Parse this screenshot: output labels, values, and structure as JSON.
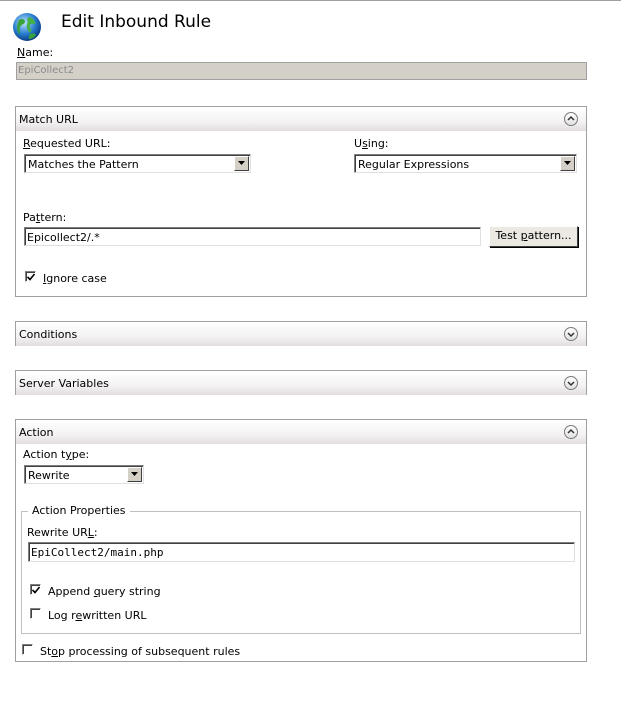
{
  "header": {
    "title": "Edit Inbound Rule",
    "icon": "globe-icon"
  },
  "name": {
    "label_pre": "",
    "label_key": "N",
    "label_post": "ame:",
    "value": "EpiCollect2"
  },
  "match_url": {
    "title": "Match URL",
    "requested_url": {
      "label_pre": "",
      "label_key": "R",
      "label_post": "equested URL:",
      "value": "Matches the Pattern"
    },
    "using": {
      "label_pre": "U",
      "label_key": "s",
      "label_post": "ing:",
      "value": "Regular Expressions"
    },
    "pattern": {
      "label_pre": "Pa",
      "label_key": "t",
      "label_post": "tern:",
      "value": "Epicollect2/.*"
    },
    "test_button": {
      "label_pre": "Test ",
      "label_key": "p",
      "label_post": "attern..."
    },
    "ignore_case": {
      "label_pre": "",
      "label_key": "I",
      "label_post": "gnore case",
      "checked": true
    }
  },
  "conditions": {
    "title": "Conditions"
  },
  "server_variables": {
    "title": "Server Variables"
  },
  "action": {
    "title": "Action",
    "action_type": {
      "label_pre": "Action t",
      "label_key": "y",
      "label_post": "pe:",
      "value": "Rewrite"
    },
    "properties": {
      "legend": "Action Properties",
      "rewrite_url": {
        "label_pre": "Rewrite UR",
        "label_key": "L",
        "label_post": ":",
        "value": "EpiCollect2/main.php"
      },
      "append_query": {
        "label_pre": "Append ",
        "label_key": "q",
        "label_post": "uery string",
        "checked": true
      },
      "log_rewritten": {
        "label_pre": "Log r",
        "label_key": "e",
        "label_post": "written URL",
        "checked": false
      }
    },
    "stop_processing": {
      "label_pre": "St",
      "label_key": "o",
      "label_post": "p processing of subsequent rules",
      "checked": false
    }
  },
  "colors": {
    "panel_border": "#a0a0a0",
    "readonly_bg": "#d4d0c8",
    "readonly_text": "#8a8a8a"
  }
}
